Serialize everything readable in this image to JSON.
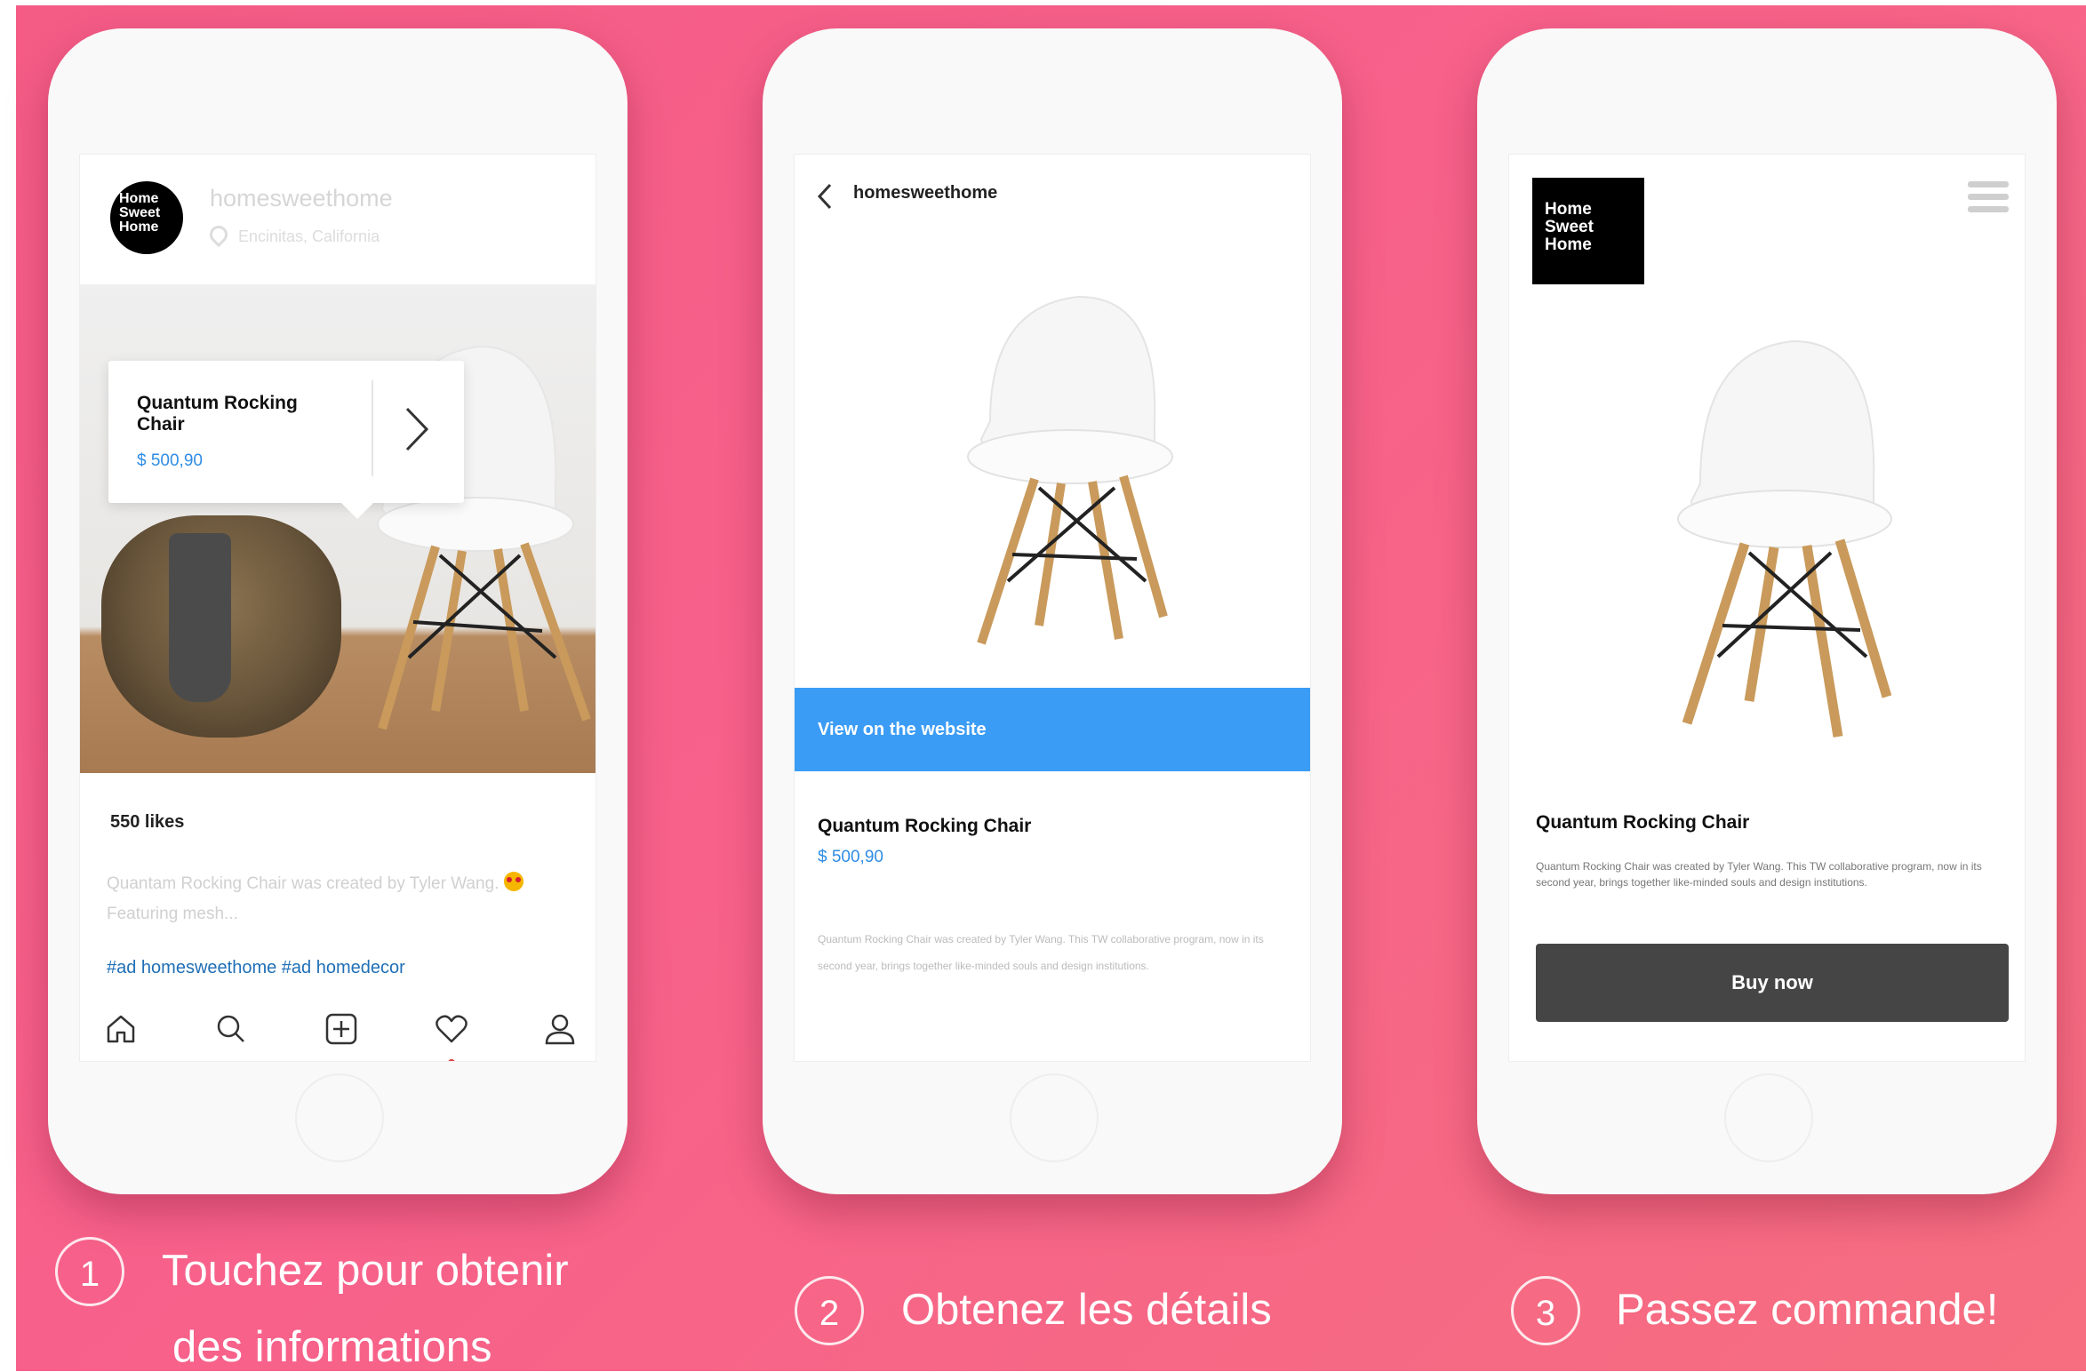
{
  "colors": {
    "background": "#f7618a",
    "accent_blue": "#3b9cf5",
    "price_blue": "#2f8de4",
    "buy_button": "#454545"
  },
  "phone1": {
    "logo_text": "Home\nSweet\nHome",
    "username": "homesweethome",
    "location": "Encinitas, California",
    "tooltip": {
      "title": "Quantum Rocking Chair",
      "price": "$ 500,90"
    },
    "likes": "550 likes",
    "caption": "Quantam Rocking Chair was created by Tyler Wang.",
    "caption_more": "Featuring mesh...",
    "tags": "#ad  homesweethome #ad  homedecor",
    "nav_icons": [
      "home-icon",
      "search-icon",
      "add-post-icon",
      "heart-icon",
      "profile-icon"
    ]
  },
  "phone2": {
    "username": "homesweethome",
    "cta": "View on the website",
    "title": "Quantum Rocking Chair",
    "price": "$ 500,90",
    "description": "Quantum Rocking Chair was created by Tyler Wang. This TW collaborative program, now in its second year, brings together like-minded souls and design institutions."
  },
  "phone3": {
    "logo_text": "Home\nSweet\nHome",
    "title": "Quantum Rocking Chair",
    "description": "Quantum Rocking Chair was created by Tyler Wang. This TW collaborative program, now in its second year, brings together like-minded souls and design institutions.",
    "buy_label": "Buy now"
  },
  "steps": [
    {
      "number": "1",
      "line1": "Touchez pour obtenir",
      "line2": "des informations"
    },
    {
      "number": "2",
      "line1": "Obtenez les détails"
    },
    {
      "number": "3",
      "line1": "Passez commande!"
    }
  ]
}
